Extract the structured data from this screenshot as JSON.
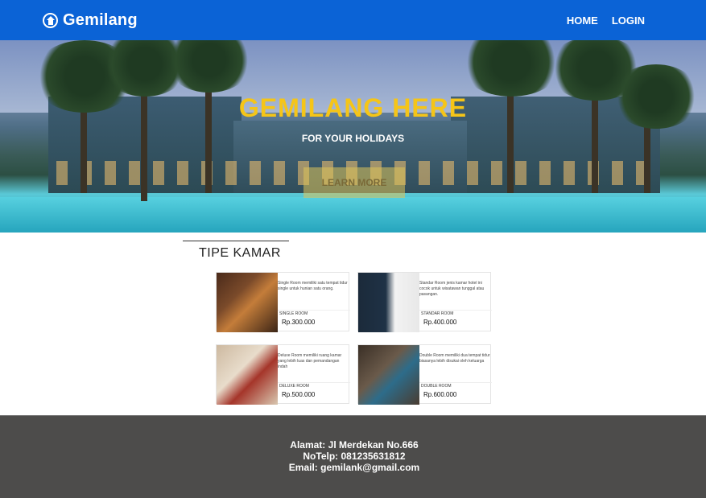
{
  "navbar": {
    "brand": "Gemilang",
    "links": [
      "HOME",
      "LOGIN"
    ]
  },
  "hero": {
    "title": "GEMILANG HERE",
    "subtitle": "FOR YOUR HOLIDAYS",
    "button": "LEARN MORE"
  },
  "section": {
    "title": "TIPE KAMAR"
  },
  "rooms": [
    {
      "description": "Single Room memiliki satu tempat tidur single untuk hunian satu orang.",
      "name": "SINGLE ROOM",
      "price": "Rp.300.000"
    },
    {
      "description": "Standar Room jenis kamar hotel ini cocok untuk wisatawan tunggal atau pasangan.",
      "name": "STANDAR ROOM",
      "price": "Rp.400.000"
    },
    {
      "description": "Deluxe Room memiliki ruang kamar yang lebih luas dan pemandangan indah",
      "name": "DELUXE ROOM",
      "price": "Rp.500.000"
    },
    {
      "description": "Double Room memiliki dua tempat tidur biasanya lebih disukai oleh keluarga",
      "name": "DOUBLE ROOM",
      "price": "Rp.600.000"
    }
  ],
  "footer": {
    "address": "Alamat: Jl Merdekan No.666",
    "phone": "NoTelp: 081235631812",
    "email": "Email: gemilank@gmail.com"
  }
}
